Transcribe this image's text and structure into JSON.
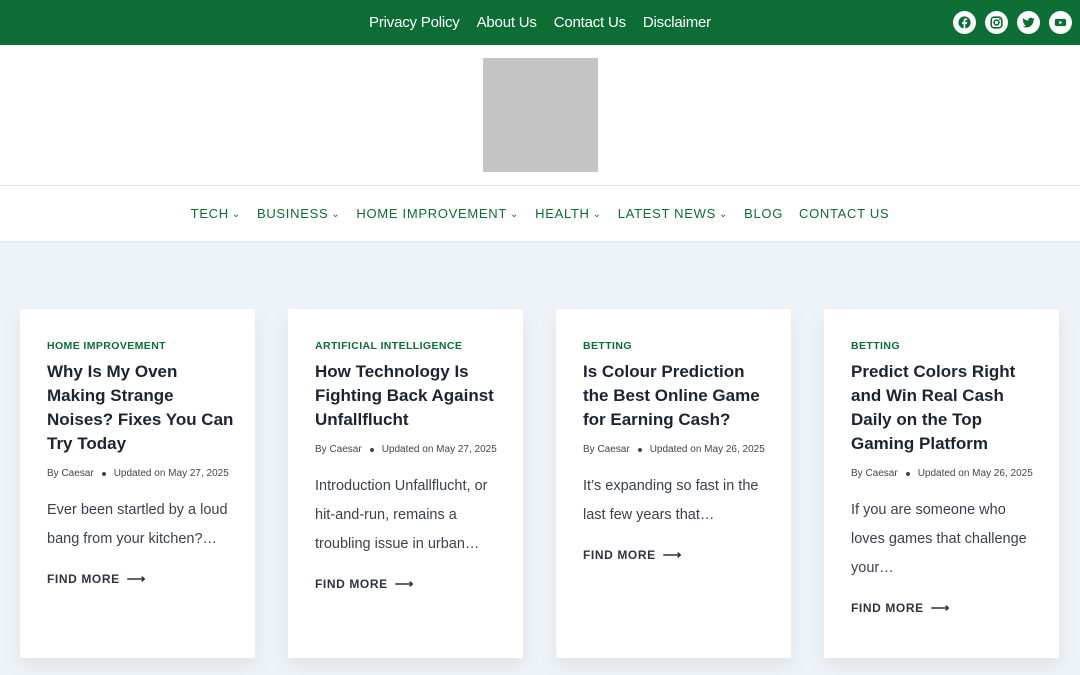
{
  "topbar": {
    "links": [
      "Privacy Policy",
      "About Us",
      "Contact Us",
      "Disclaimer"
    ],
    "social_icons": [
      "facebook-icon",
      "instagram-icon",
      "twitter-icon",
      "youtube-icon"
    ]
  },
  "main_nav": {
    "items": [
      {
        "label": "TECH",
        "has_dropdown": true
      },
      {
        "label": "BUSINESS",
        "has_dropdown": true
      },
      {
        "label": "HOME IMPROVEMENT",
        "has_dropdown": true
      },
      {
        "label": "HEALTH",
        "has_dropdown": true
      },
      {
        "label": "LATEST NEWS",
        "has_dropdown": true
      },
      {
        "label": "BLOG",
        "has_dropdown": false
      },
      {
        "label": "CONTACT US",
        "has_dropdown": false
      }
    ]
  },
  "colors": {
    "brand_green": "#0c6d35",
    "background": "#eef3f7"
  },
  "posts": [
    {
      "category": "HOME IMPROVEMENT",
      "title": "Why Is My Oven Making Strange Noises? Fixes You Can Try Today",
      "author": "By Caesar",
      "updated": "Updated on May 27, 2025",
      "excerpt": "Ever been startled by a loud bang from your kitchen?…",
      "cta": "FIND MORE"
    },
    {
      "category": "ARTIFICIAL INTELLIGENCE",
      "title": "How Technology Is Fighting Back Against Unfallflucht",
      "author": "By Caesar",
      "updated": "Updated on May 27, 2025",
      "excerpt": "Introduction Unfallflucht, or hit-and-run, remains a troubling issue in urban…",
      "cta": "FIND MORE"
    },
    {
      "category": "BETTING",
      "title": "Is Colour Prediction the Best Online Game for Earning Cash?",
      "author": "By Caesar",
      "updated": "Updated on May 26, 2025",
      "excerpt": "It’s expanding so fast in the last few years that…",
      "cta": "FIND MORE"
    },
    {
      "category": "BETTING",
      "title": "Predict Colors Right and Win Real Cash Daily on the Top Gaming Platform",
      "author": "By Caesar",
      "updated": "Updated on May 26, 2025",
      "excerpt": "If you are someone who loves games that challenge your…",
      "cta": "FIND MORE"
    }
  ]
}
